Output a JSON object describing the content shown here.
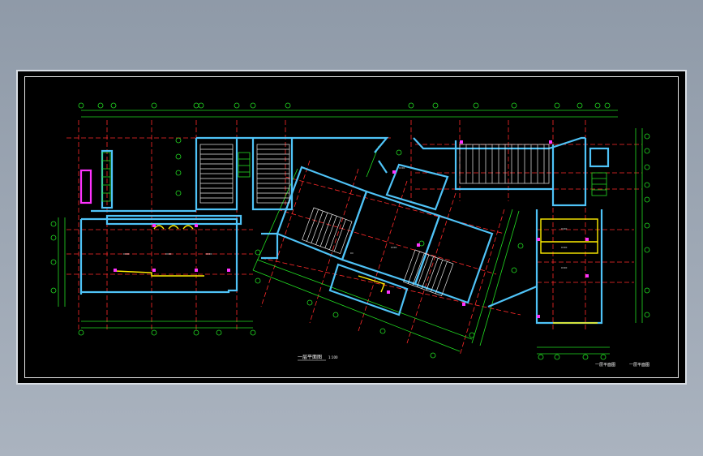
{
  "drawing": {
    "caption_main": "一层平面图",
    "caption_scale": "1:100",
    "caption_right_a": "一层平面图",
    "caption_right_b": "一层平面图"
  },
  "colors": {
    "background": "#000000",
    "wall": "#4fc3f7",
    "grid": "#ff2a2a",
    "dimension": "#22dd22",
    "stair": "#e8e8e8",
    "door": "#ffee00",
    "column": "#ff33ff",
    "annotation": "#ffffff"
  },
  "icons": {
    "axis_bubble": "grid-axis-bubble-icon"
  }
}
